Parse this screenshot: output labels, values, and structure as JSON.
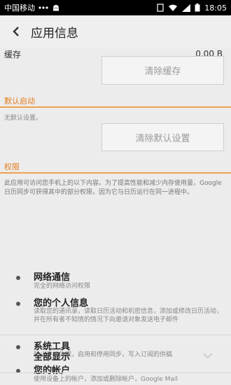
{
  "status_bar": {
    "carrier": "中国移动",
    "time": "18:05"
  },
  "header": {
    "title": "应用信息"
  },
  "storage": {
    "cache_label": "缓存",
    "cache_value": "0.00 B",
    "clear_cache_button": "清除缓存"
  },
  "default_launch": {
    "section_title": "默认启动",
    "no_default_text": "无默认设置。",
    "clear_defaults_button": "清除默认设置"
  },
  "permissions": {
    "section_title": "权限",
    "description": "此应用可访问您手机上的以下内容。为了提高性能和减少内存使用量，Google 日历同步可获得其中的部分权限，因为它与日历运行在同一进程中。",
    "items": [
      {
        "name": "网络通信",
        "detail": "完全的网络访问权限"
      },
      {
        "name": "您的个人信息",
        "detail": "读取您的通讯录，读取日历活动和机密信息，添加或修改日历活动，并在所有者不知情的情况下向邀请对象发送电子邮件"
      },
      {
        "name": "系统工具",
        "detail": "防止手机休眠，启用和停用同步，写入订阅的供稿"
      },
      {
        "name": "您的帐户",
        "detail": "使用设备上的帐户，添加或删除帐户，Google Mail"
      }
    ],
    "show_all": "全部显示"
  },
  "colors": {
    "accent": "#e47d19",
    "accent_line": "#f0a14b",
    "background": "#ececec"
  }
}
